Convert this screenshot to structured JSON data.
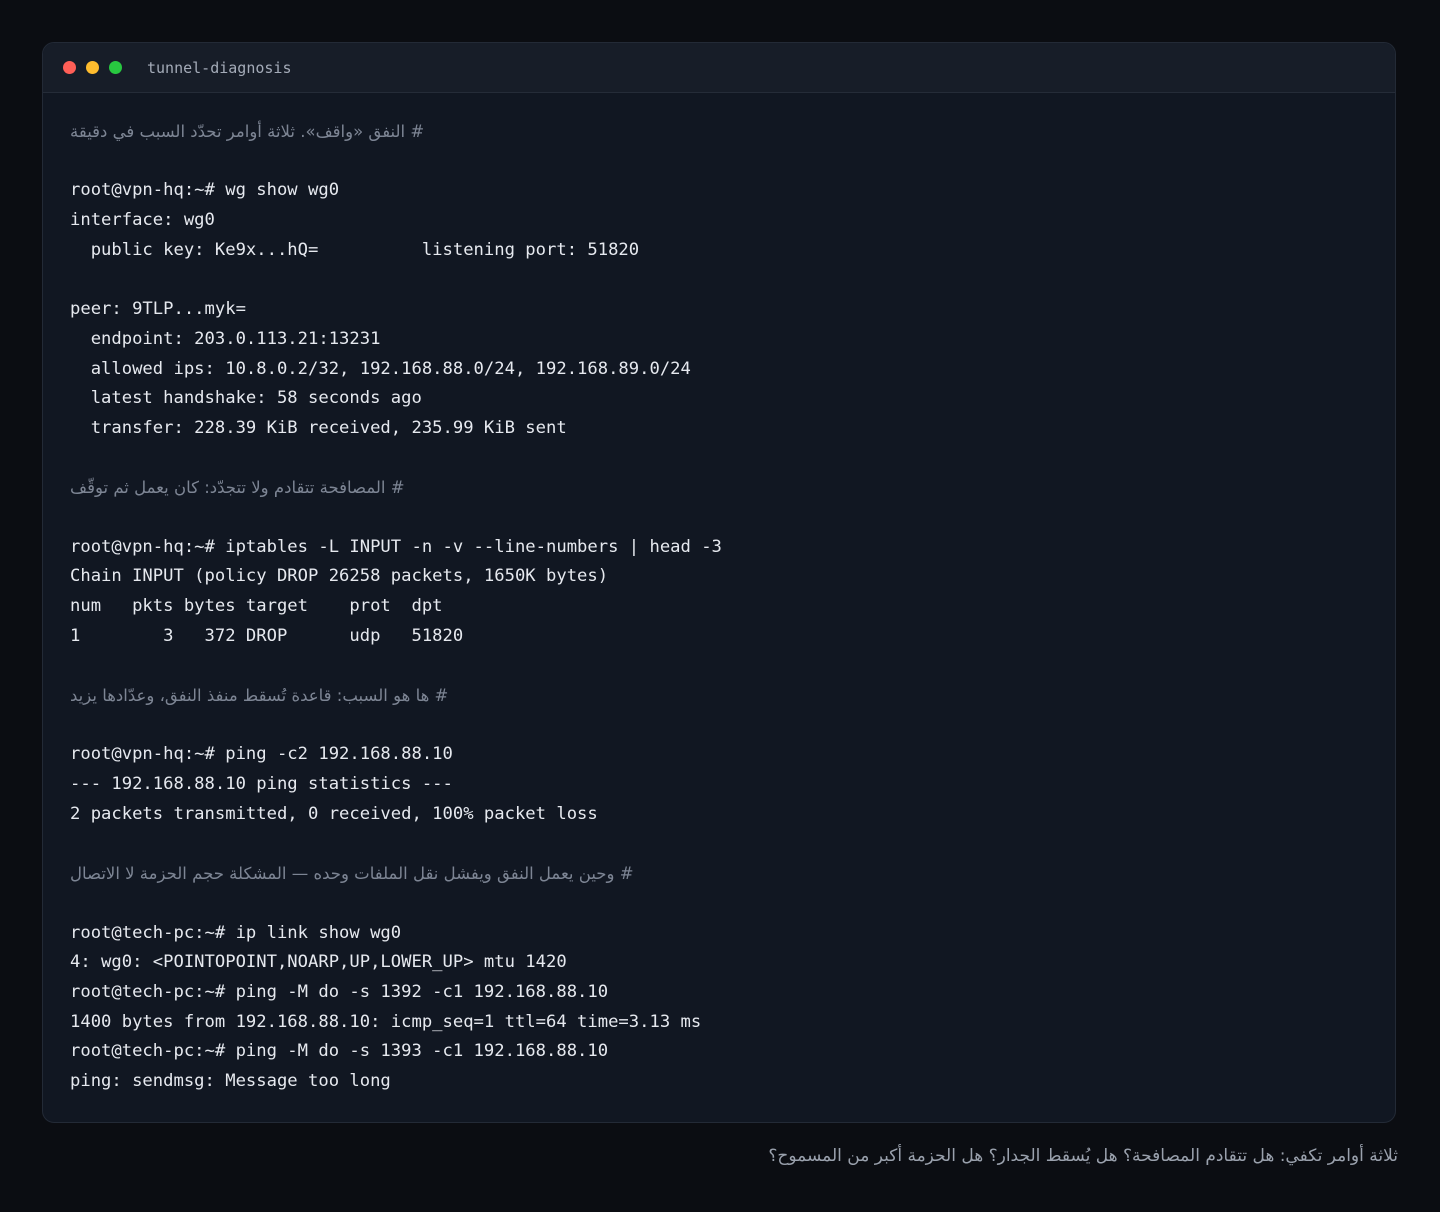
{
  "window": {
    "title": "tunnel-diagnosis"
  },
  "lines": [
    {
      "type": "comment",
      "text": "# النفق «واقف». ثلاثة أوامر تحدّد السبب في دقيقة"
    },
    {
      "type": "blank",
      "text": ""
    },
    {
      "type": "output",
      "text": "root@vpn-hq:~# wg show wg0"
    },
    {
      "type": "output",
      "text": "interface: wg0"
    },
    {
      "type": "output",
      "text": "  public key: Ke9x...hQ=          listening port: 51820"
    },
    {
      "type": "blank",
      "text": ""
    },
    {
      "type": "output",
      "text": "peer: 9TLP...myk="
    },
    {
      "type": "output",
      "text": "  endpoint: 203.0.113.21:13231"
    },
    {
      "type": "output",
      "text": "  allowed ips: 10.8.0.2/32, 192.168.88.0/24, 192.168.89.0/24"
    },
    {
      "type": "output",
      "text": "  latest handshake: 58 seconds ago"
    },
    {
      "type": "output",
      "text": "  transfer: 228.39 KiB received, 235.99 KiB sent"
    },
    {
      "type": "blank",
      "text": ""
    },
    {
      "type": "comment",
      "text": "# المصافحة تتقادم ولا تتجدّد: كان يعمل ثم توقّف"
    },
    {
      "type": "blank",
      "text": ""
    },
    {
      "type": "output",
      "text": "root@vpn-hq:~# iptables -L INPUT -n -v --line-numbers | head -3"
    },
    {
      "type": "output",
      "text": "Chain INPUT (policy DROP 26258 packets, 1650K bytes)"
    },
    {
      "type": "output",
      "text": "num   pkts bytes target    prot  dpt"
    },
    {
      "type": "output",
      "text": "1        3   372 DROP      udp   51820"
    },
    {
      "type": "blank",
      "text": ""
    },
    {
      "type": "comment",
      "text": "# ها هو السبب: قاعدة تُسقط منفذ النفق، وعدّادها يزيد"
    },
    {
      "type": "blank",
      "text": ""
    },
    {
      "type": "output",
      "text": "root@vpn-hq:~# ping -c2 192.168.88.10"
    },
    {
      "type": "output",
      "text": "--- 192.168.88.10 ping statistics ---"
    },
    {
      "type": "output",
      "text": "2 packets transmitted, 0 received, 100% packet loss"
    },
    {
      "type": "blank",
      "text": ""
    },
    {
      "type": "comment",
      "text": "# وحين يعمل النفق ويفشل نقل الملفات وحده — المشكلة حجم الحزمة لا الاتصال"
    },
    {
      "type": "blank",
      "text": ""
    },
    {
      "type": "output",
      "text": "root@tech-pc:~# ip link show wg0"
    },
    {
      "type": "output",
      "text": "4: wg0: <POINTOPOINT,NOARP,UP,LOWER_UP> mtu 1420"
    },
    {
      "type": "output",
      "text": "root@tech-pc:~# ping -M do -s 1392 -c1 192.168.88.10"
    },
    {
      "type": "output",
      "text": "1400 bytes from 192.168.88.10: icmp_seq=1 ttl=64 time=3.13 ms"
    },
    {
      "type": "output",
      "text": "root@tech-pc:~# ping -M do -s 1393 -c1 192.168.88.10"
    },
    {
      "type": "output",
      "text": "ping: sendmsg: Message too long"
    }
  ],
  "caption": "ثلاثة أوامر تكفي: هل تتقادم المصافحة؟ هل يُسقط الجدار؟ هل الحزمة أكبر من المسموح؟",
  "colors": {
    "close": "#ff5f57",
    "minimize": "#febc2e",
    "maximize": "#28c840",
    "text": "#e6e9ef",
    "comment": "#7d8594"
  }
}
